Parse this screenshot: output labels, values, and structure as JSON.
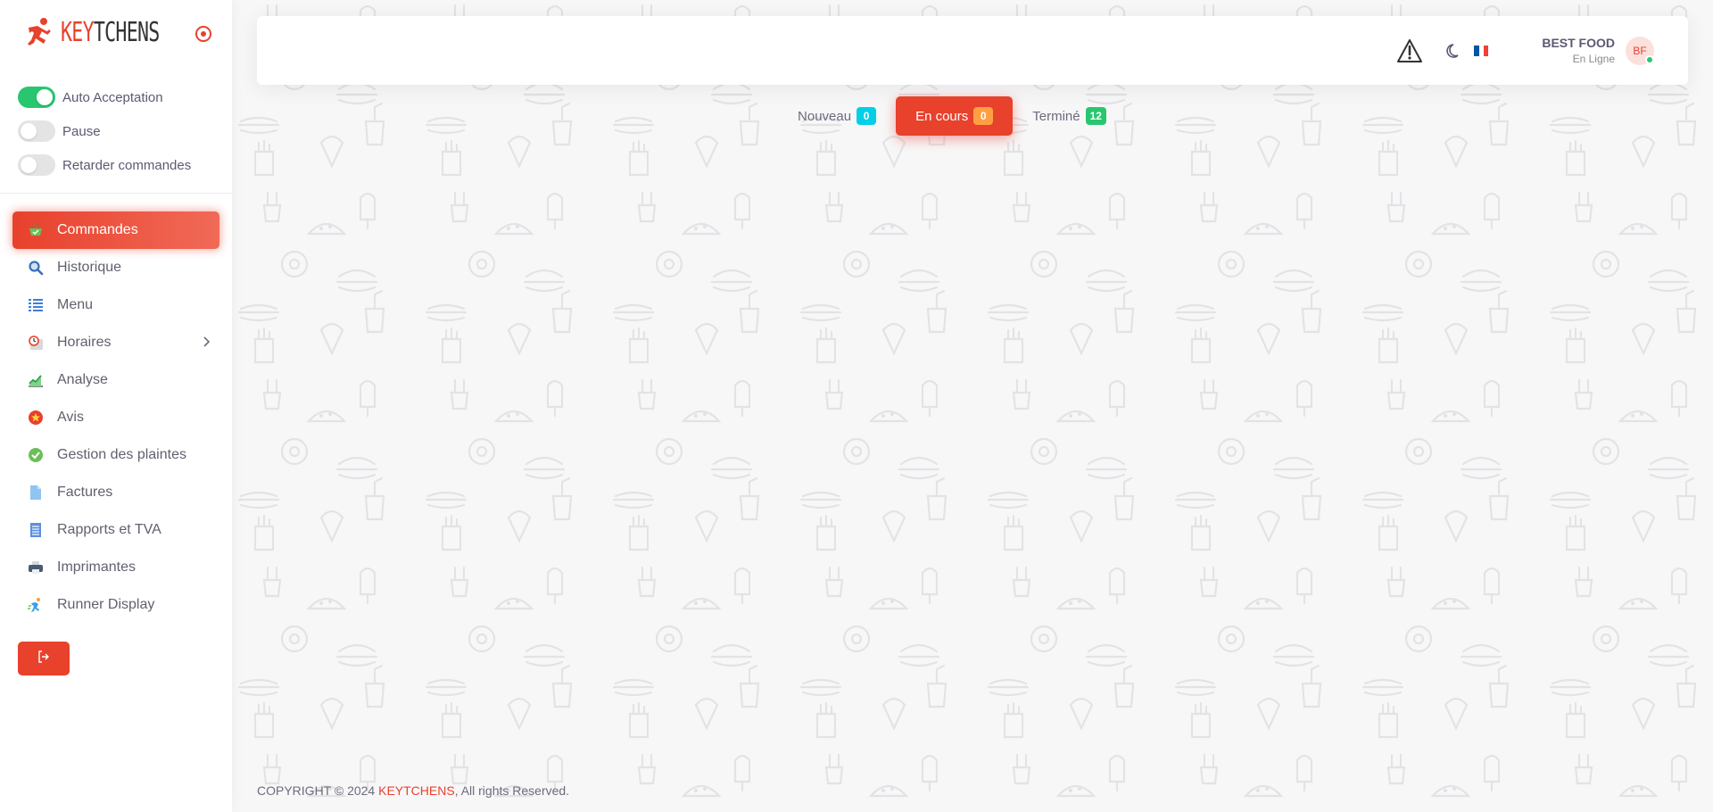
{
  "brand": {
    "name_part1": "KEY",
    "name_part2": "TCHENS"
  },
  "toggles": [
    {
      "label": "Auto Acceptation",
      "on": true
    },
    {
      "label": "Pause",
      "on": false
    },
    {
      "label": "Retarder commandes",
      "on": false
    }
  ],
  "menu": {
    "items": [
      {
        "label": "Commandes",
        "icon": "shopping-basket-icon",
        "active": true
      },
      {
        "label": "Historique",
        "icon": "search-icon"
      },
      {
        "label": "Menu",
        "icon": "list-icon"
      },
      {
        "label": "Horaires",
        "icon": "clock-icon",
        "has_submenu": true
      },
      {
        "label": "Analyse",
        "icon": "chart-icon"
      },
      {
        "label": "Avis",
        "icon": "star-icon"
      },
      {
        "label": "Gestion des plaintes",
        "icon": "check-circle-icon"
      },
      {
        "label": "Factures",
        "icon": "document-icon"
      },
      {
        "label": "Rapports et TVA",
        "icon": "report-icon"
      },
      {
        "label": "Imprimantes",
        "icon": "printer-icon"
      },
      {
        "label": "Runner Display",
        "icon": "runner-icon"
      }
    ],
    "logout_icon": "logout-icon"
  },
  "header": {
    "user_name": "BEST FOOD",
    "user_status": "En Ligne",
    "avatar_initials": "BF",
    "language": "fr"
  },
  "tabs": [
    {
      "label": "Nouveau",
      "count": "0",
      "badge_color": "#00cfe8"
    },
    {
      "label": "En cours",
      "count": "0",
      "badge_color": "#ff9f43",
      "active": true
    },
    {
      "label": "Terminé",
      "count": "12",
      "badge_color": "#28c76f"
    }
  ],
  "footer": {
    "prefix": "COPYRIGHT © 2024 ",
    "brand": "KEYTCHENS",
    "suffix": ", All rights Reserved."
  },
  "colors": {
    "accent": "#e8412c",
    "success": "#28c76f",
    "info": "#00cfe8",
    "warning": "#ff9f43"
  }
}
